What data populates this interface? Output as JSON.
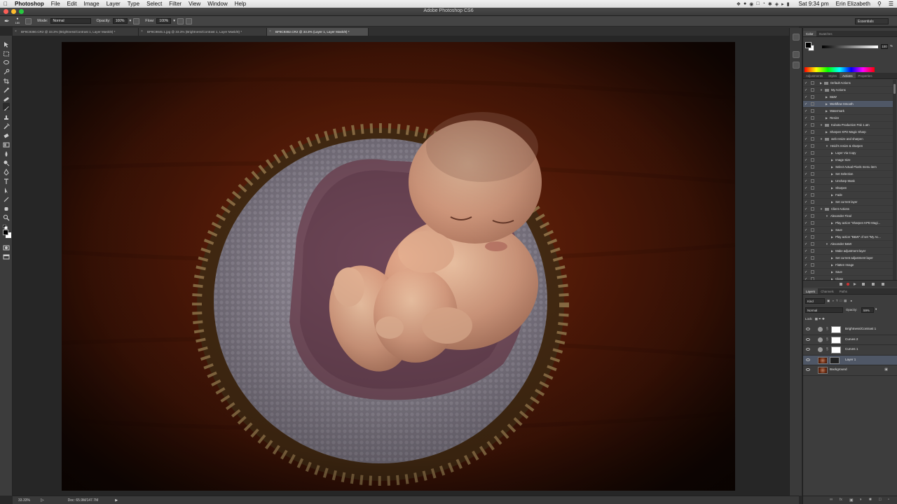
{
  "os_menubar": {
    "items": [
      "Photoshop",
      "File",
      "Edit",
      "Image",
      "Layer",
      "Type",
      "Select",
      "Filter",
      "View",
      "Window",
      "Help"
    ],
    "clock": "Sat 9:34 pm",
    "user": "Erin Elizabeth"
  },
  "window": {
    "title": "Adobe Photoshop CS6"
  },
  "options_bar": {
    "brush_size": "180",
    "mode_label": "Mode:",
    "mode_value": "Normal",
    "opacity_label": "Opacity:",
    "opacity_value": "100%",
    "flow_label": "Flow:",
    "flow_value": "100%",
    "workspace": "Essentials"
  },
  "doc_tabs": [
    {
      "label": "BF8C9380.CR2 @ 33.3% (Brightness/Contrast 1, Layer Mask/8) *",
      "active": false
    },
    {
      "label": "BF8C9845.1.jpg @ 33.3% (Brightness/Contrast 1, Layer Mask/8) *",
      "active": false
    },
    {
      "label": "BF8C9382.CR2 @ 33.3% (Layer 1, Layer Mask/8) *",
      "active": true
    }
  ],
  "status_bar": {
    "zoom": "33.33%",
    "doc": "Doc: 65.9M/147.7M"
  },
  "color_panel": {
    "tabs": [
      "Color",
      "Swatches"
    ],
    "k_value": "100",
    "k_unit": "%"
  },
  "actions_panel": {
    "tabs": [
      "Adjustments",
      "Styles",
      "Actions",
      "Properties"
    ],
    "items": [
      {
        "label": "Default Actions",
        "level": 0,
        "kind": "set",
        "expanded": false,
        "selected": false
      },
      {
        "label": "My Actions",
        "level": 0,
        "kind": "set",
        "expanded": true,
        "selected": false
      },
      {
        "label": "B&W",
        "level": 1,
        "kind": "action",
        "expanded": false,
        "selected": false
      },
      {
        "label": "Workflow Smooth",
        "level": 1,
        "kind": "action",
        "expanded": false,
        "selected": true
      },
      {
        "label": "Watermark",
        "level": 1,
        "kind": "action",
        "expanded": false,
        "selected": false
      },
      {
        "label": "Resize",
        "level": 1,
        "kind": "action",
        "expanded": false,
        "selected": false
      },
      {
        "label": "Kubota Production Pak 1.atn",
        "level": 0,
        "kind": "set",
        "expanded": true,
        "selected": false
      },
      {
        "label": "Sharpen KPD Magic Sharp",
        "level": 1,
        "kind": "action",
        "expanded": false,
        "selected": false
      },
      {
        "label": "web resize and sharpen",
        "level": 0,
        "kind": "set",
        "expanded": true,
        "selected": false
      },
      {
        "label": "Heidi's resize & sharpen",
        "level": 1,
        "kind": "action",
        "expanded": true,
        "selected": false
      },
      {
        "label": "Layer Via Copy",
        "level": 2,
        "kind": "step",
        "expanded": false,
        "selected": false
      },
      {
        "label": "Image Size",
        "level": 2,
        "kind": "step",
        "expanded": false,
        "selected": false
      },
      {
        "label": "Select Actual Pixels menu item",
        "level": 2,
        "kind": "step",
        "expanded": false,
        "selected": false
      },
      {
        "label": "Set Selection",
        "level": 2,
        "kind": "step",
        "expanded": false,
        "selected": false
      },
      {
        "label": "Unsharp Mask",
        "level": 2,
        "kind": "step",
        "expanded": false,
        "selected": false
      },
      {
        "label": "Sharpen",
        "level": 2,
        "kind": "step",
        "expanded": false,
        "selected": false
      },
      {
        "label": "Fade",
        "level": 2,
        "kind": "step",
        "expanded": false,
        "selected": false
      },
      {
        "label": "Set current layer",
        "level": 2,
        "kind": "step",
        "expanded": false,
        "selected": false
      },
      {
        "label": "Client Actions",
        "level": 0,
        "kind": "set",
        "expanded": true,
        "selected": false
      },
      {
        "label": "Alexander Final",
        "level": 1,
        "kind": "action",
        "expanded": true,
        "selected": false
      },
      {
        "label": "Play action \"Sharpen KPD Magi...",
        "level": 2,
        "kind": "step",
        "expanded": false,
        "selected": false
      },
      {
        "label": "Save",
        "level": 2,
        "kind": "step",
        "expanded": false,
        "selected": false
      },
      {
        "label": "Play action \"B&W\" of set \"My Ac...",
        "level": 2,
        "kind": "step",
        "expanded": false,
        "selected": false
      },
      {
        "label": "Alexander B&W",
        "level": 1,
        "kind": "action",
        "expanded": true,
        "selected": false
      },
      {
        "label": "Make adjustment layer",
        "level": 2,
        "kind": "step",
        "expanded": false,
        "selected": false
      },
      {
        "label": "Set current adjustment layer",
        "level": 2,
        "kind": "step",
        "expanded": false,
        "selected": false
      },
      {
        "label": "Flatten Image",
        "level": 2,
        "kind": "step",
        "expanded": false,
        "selected": false
      },
      {
        "label": "Save",
        "level": 2,
        "kind": "step",
        "expanded": false,
        "selected": false
      },
      {
        "label": "Close",
        "level": 2,
        "kind": "step",
        "expanded": false,
        "selected": false
      }
    ]
  },
  "layers_panel": {
    "tabs": [
      "Layers",
      "Channels",
      "Paths"
    ],
    "kind_label": "Kind",
    "blend_mode": "Normal",
    "opacity_label": "Opacity:",
    "opacity_value": "59%",
    "lock_label": "Lock:",
    "layers": [
      {
        "name": "Brightness/Contrast 1",
        "type": "adjustment",
        "selected": false,
        "locked": false
      },
      {
        "name": "Curves 2",
        "type": "adjustment",
        "selected": false,
        "locked": false
      },
      {
        "name": "Curves 1",
        "type": "adjustment",
        "selected": false,
        "locked": false
      },
      {
        "name": "Layer 1",
        "type": "pixel-with-mask",
        "selected": true,
        "locked": false
      },
      {
        "name": "Background",
        "type": "pixel",
        "selected": false,
        "locked": true
      }
    ]
  },
  "colors": {
    "app_bg": "#282828",
    "panel_bg": "#3d3d3d",
    "selection": "#4f5766"
  }
}
